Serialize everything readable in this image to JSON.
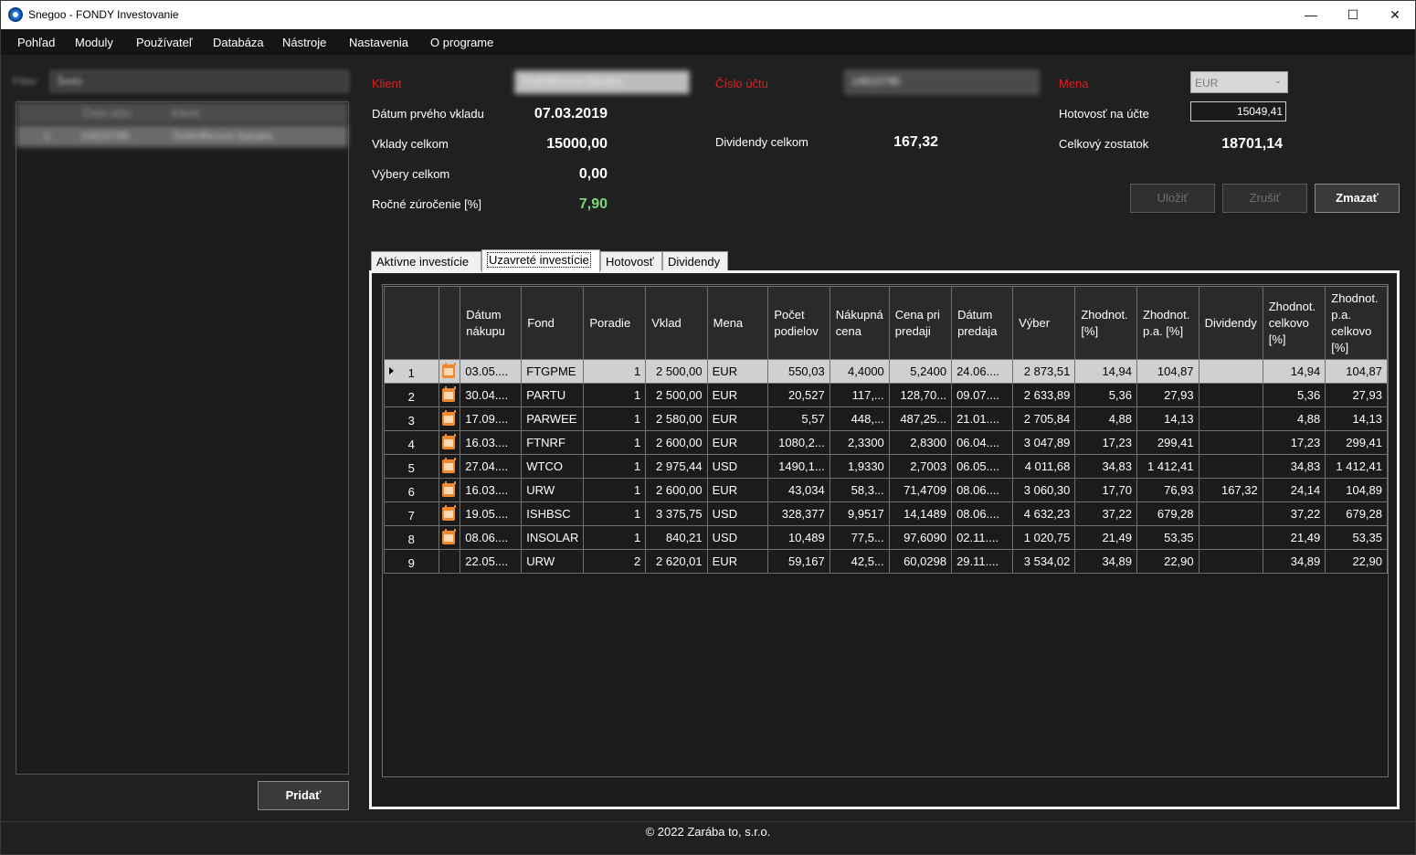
{
  "window": {
    "title": "Snegoo - FONDY Investovanie",
    "minimize": "—",
    "maximize": "☐",
    "close": "✕"
  },
  "menu": [
    "Pohľad",
    "Moduly",
    "Používateľ",
    "Databáza",
    "Nástroje",
    "Nastavenia",
    "O programe"
  ],
  "left": {
    "filter_label": "Filter",
    "filter_value": "Šedo",
    "list_headers": [
      "Číslo účtu",
      "Klient"
    ],
    "list_row": [
      "1",
      "14810795",
      "Tinifinfferová Sandra"
    ],
    "add_button": "Pridať"
  },
  "header": {
    "client_label": "Klient",
    "client_value": "Tinifinfferová Sandra",
    "account_label": "Číslo účtu",
    "account_value": "14810795",
    "currency_label": "Mena",
    "currency_value": "EUR",
    "first_deposit_label": "Dátum prvého vkladu",
    "first_deposit_value": "07.03.2019",
    "deposits_label": "Vklady celkom",
    "deposits_value": "15000,00",
    "withdrawals_label": "Výbery celkom",
    "withdrawals_value": "0,00",
    "annual_label": "Ročné zúročenie [%]",
    "annual_value": "7,90",
    "dividends_label": "Dividendy celkom",
    "dividends_value": "167,32",
    "cash_label": "Hotovosť na účte",
    "cash_value": "15049,41",
    "balance_label": "Celkový zostatok",
    "balance_value": "18701,14"
  },
  "buttons": {
    "save": "Uložiť",
    "cancel": "Zrušiť",
    "delete": "Zmazať"
  },
  "tabs": [
    "Aktívne investície",
    "Uzavreté investície",
    "Hotovosť",
    "Dividendy"
  ],
  "table": {
    "columns": [
      "",
      "",
      "Dátum nákupu",
      "Fond",
      "Poradie",
      "Vklad",
      "Mena",
      "Počet podielov",
      "Nákupná cena",
      "Cena pri predaji",
      "Dátum predaja",
      "Výber",
      "Zhodnot. [%]",
      "Zhodnot. p.a. [%]",
      "Dividendy",
      "Zhodnot. celkovo [%]",
      "Zhodnot. p.a. celkovo [%]"
    ],
    "rows": [
      [
        "1",
        "03.05....",
        "FTGPME",
        "1",
        "2 500,00",
        "EUR",
        "550,03",
        "4,4000",
        "5,2400",
        "24.06....",
        "2 873,51",
        "14,94",
        "104,87",
        "",
        "14,94",
        "104,87"
      ],
      [
        "2",
        "30.04....",
        "PARTU",
        "1",
        "2 500,00",
        "EUR",
        "20,527",
        "117,...",
        "128,70...",
        "09.07....",
        "2 633,89",
        "5,36",
        "27,93",
        "",
        "5,36",
        "27,93"
      ],
      [
        "3",
        "17.09....",
        "PARWEE",
        "1",
        "2 580,00",
        "EUR",
        "5,57",
        "448,...",
        "487,25...",
        "21.01....",
        "2 705,84",
        "4,88",
        "14,13",
        "",
        "4,88",
        "14,13"
      ],
      [
        "4",
        "16.03....",
        "FTNRF",
        "1",
        "2 600,00",
        "EUR",
        "1080,2...",
        "2,3300",
        "2,8300",
        "06.04....",
        "3 047,89",
        "17,23",
        "299,41",
        "",
        "17,23",
        "299,41"
      ],
      [
        "5",
        "27.04....",
        "WTCO",
        "1",
        "2 975,44",
        "USD",
        "1490,1...",
        "1,9330",
        "2,7003",
        "06.05....",
        "4 011,68",
        "34,83",
        "1 412,41",
        "",
        "34,83",
        "1 412,41"
      ],
      [
        "6",
        "16.03....",
        "URW",
        "1",
        "2 600,00",
        "EUR",
        "43,034",
        "58,3...",
        "71,4709",
        "08.06....",
        "3 060,30",
        "17,70",
        "76,93",
        "167,32",
        "24,14",
        "104,89"
      ],
      [
        "7",
        "19.05....",
        "ISHBSC",
        "1",
        "3 375,75",
        "USD",
        "328,377",
        "9,9517",
        "14,1489",
        "08.06....",
        "4 632,23",
        "37,22",
        "679,28",
        "",
        "37,22",
        "679,28"
      ],
      [
        "8",
        "08.06....",
        "INSOLAR",
        "1",
        "840,21",
        "USD",
        "10,489",
        "77,5...",
        "97,6090",
        "02.11....",
        "1 020,75",
        "21,49",
        "53,35",
        "",
        "21,49",
        "53,35"
      ],
      [
        "9",
        "22.05....",
        "URW",
        "2",
        "2 620,01",
        "EUR",
        "59,167",
        "42,5...",
        "60,0298",
        "29.11....",
        "3 534,02",
        "34,89",
        "22,90",
        "",
        "34,89",
        "22,90"
      ]
    ],
    "has_icon": [
      true,
      true,
      true,
      true,
      true,
      true,
      true,
      true,
      false
    ]
  },
  "footer": "© 2022 Zarába to, s.r.o."
}
